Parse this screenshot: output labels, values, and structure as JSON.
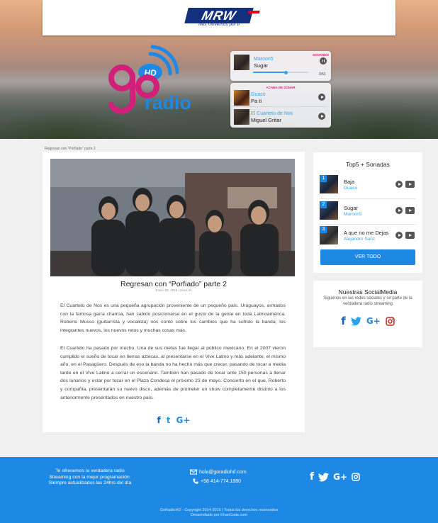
{
  "brand": {
    "mrw_logo": "MRW",
    "mrw_tagline": "Nos movemos por ti",
    "station_logo_text": "radio",
    "station_logo_hd": "HD"
  },
  "now_playing": {
    "badge": "SONANDO",
    "artist": "Maroon5",
    "title": "Sugar",
    "time": "3:51",
    "progress_fraction": 0.6,
    "recent_label": "ACABA DE SONAR",
    "recent": [
      {
        "artist": "Guaco",
        "title": "Pa ti"
      },
      {
        "artist": "El Cuarteto de Nos",
        "title": "Miguel Gritar"
      }
    ]
  },
  "breadcrumb": "Regresan con \"Porfiado\" parte 2",
  "article": {
    "title": "Regresan con “Porfiado” parte 2",
    "meta": "Enero 08, 2016  |  Hace 5s",
    "paragraphs": [
      "El Cuarteto de Nos es una pequeña agrupación proveniente de un pequeño país. Uruguayos, armados con la famosa garra charrúa, han sabido posicionarse en el gusto de la gente en toda Latinoamérica. Roberto Musso (guitarrista y vocalista) nos contó sobre los cambios que ha sufrido la banda; los integrantes nuevos, los nuevos retos y muchas cosas más.",
      "El Cuarteto ha pasado por mucho. Una de sus metas fue llegar al público mexicano. En el 2007 vieron cumplido el sueño de tocar en tierras aztecas, al presentarse en el Vive Latino y más adelante, el mismo año, en el Pasagüero. Después de eso la banda no ha hecho más que crecer, pasando de tocar a media tarde en el Vive Latino a cerrar un escenario. También han pasado de tocar ante 150 personas a llenar dos lunarios y estar por tocar en el Plaza Condesa el próximo 23 de mayo. Concierto en el que, Roberto y compañía, presentarán su nuevo disco, además de prometer un show completamente distinto a los anteriormente presentados en nuestro país."
    ],
    "share": {
      "facebook": "f",
      "twitter": "t",
      "gplus": "G+"
    }
  },
  "top5": {
    "title": "Top5 + Sonadas",
    "items": [
      {
        "rank": "1",
        "song": "Baja",
        "artist": "Guaco"
      },
      {
        "rank": "2",
        "song": "Sugar",
        "artist": "Maroon5"
      },
      {
        "rank": "3",
        "song": "A que no me Dejas",
        "artist": "Alejandro Sanz"
      }
    ],
    "button": "VER TODO"
  },
  "social": {
    "title": "Nuestras SocialMedia",
    "subtitle": "Siguenos en las redes sociales y se parte de la verdadera radio streaming"
  },
  "footer": {
    "text": "Te ofrecemos la verdadera radio Streaming con la mejor programación. Siempre actualizados las 24hrs del día",
    "email": "hola@goradiohd.com",
    "phone": "+58 414-774.1880",
    "copyright": "GoRadioHD - Copyright 2014-2016  |  Todos los derechos reservados",
    "credit": "Desarrollado por KhanCode.com"
  },
  "colors": {
    "accent": "#1e88e5",
    "brand_pink": "#d0207a",
    "mrw_blue": "#13307f"
  },
  "icons": [
    "facebook-icon",
    "twitter-icon",
    "gplus-icon",
    "instagram-icon",
    "play-icon",
    "pause-icon",
    "youtube-icon",
    "mail-icon",
    "phone-icon"
  ]
}
